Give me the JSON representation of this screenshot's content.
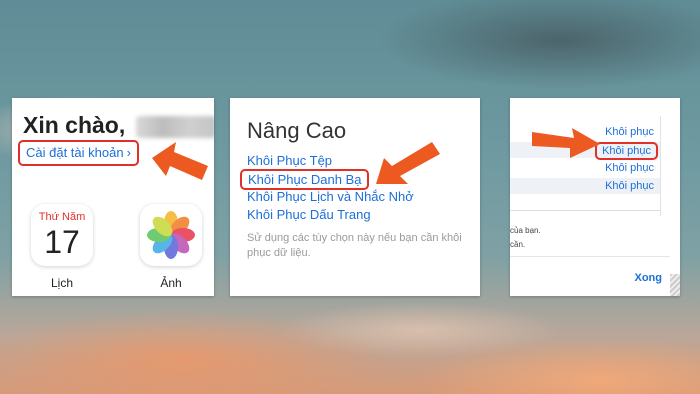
{
  "colors": {
    "accent_red": "#e0302a",
    "link_blue": "#1c6fd8",
    "arrow_orange": "#ec5a21"
  },
  "panel1": {
    "greeting": "Xin chào,",
    "account_settings": "Cài đặt tài khoản",
    "chevron_icon": "chevron-right-icon",
    "calendar": {
      "day_name": "Thứ Năm",
      "day_number": "17",
      "label": "Lịch"
    },
    "photos": {
      "label": "Ảnh"
    }
  },
  "panel2": {
    "title": "Nâng Cao",
    "links": [
      "Khôi Phục Tệp",
      "Khôi Phục Danh Bạ",
      "Khôi Phục Lịch và Nhắc Nhở",
      "Khôi Phục Dấu Trang"
    ],
    "note": "Sử dụng các tùy chọn này nếu bạn cần khôi phục dữ liệu."
  },
  "panel3": {
    "restore_buttons": [
      "Khôi phục",
      "Khôi phục",
      "Khôi phục",
      "Khôi phục"
    ],
    "fragment_1": "của bạn.",
    "fragment_2": "cần.",
    "done": "Xong"
  }
}
